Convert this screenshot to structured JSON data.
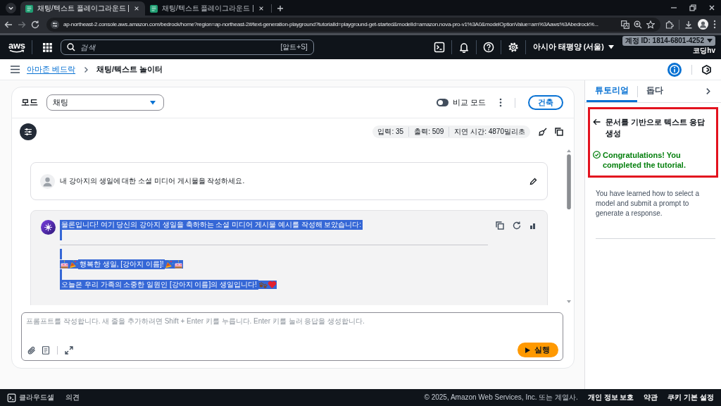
{
  "browser": {
    "tabs": [
      {
        "title": "채팅/텍스트 플레이그라운드 |",
        "selected": true
      },
      {
        "title": "채팅/텍스트 플레이그라운드 |",
        "selected": false
      }
    ],
    "url": "ap-northeast-2.console.aws.amazon.com/bedrock/home?region=ap-northeast-2#/text-generation-playground?tutorialId=playground-get-started&modelId=amazon.nova-pro-v1%3A0&modelOptionValue=arn%3Aaws%3Abedrock%..."
  },
  "console_header": {
    "logo": "aws",
    "search": {
      "placeholder": "검색",
      "shortcut": "[알트+S]"
    },
    "region": "아시아 태평양 (서울)",
    "account_id": "계정 ID: 1814-6801-4252",
    "user": "코딩hv"
  },
  "breadcrumbs": [
    {
      "label": "아마존 베드락",
      "kind": "link"
    },
    {
      "label": "채팅/텍스트 놀이터",
      "kind": "current"
    }
  ],
  "playground": {
    "mode_label": "모드",
    "mode_select": {
      "value": "채팅"
    },
    "compare_toggle": {
      "label": "비교 모드",
      "on": false
    },
    "build_button": "건축",
    "stats": [
      "입력: 35",
      "출력: 509",
      "지연 시간: 4870밀리초"
    ],
    "messages": [
      {
        "kind": "user",
        "text": "내 강아지의 생일에 대한 소셜 미디어 게시물을 작성하세요."
      },
      {
        "kind": "assistant",
        "blocks": [
          {
            "kind": "text",
            "text": "물론입니다! 여기 당신의 강아지 생일을 축하하는 소셜 미디어 게시물 예시를 작성해 보았습니다:",
            "selected": true
          },
          {
            "kind": "blank",
            "selected": true
          },
          {
            "kind": "rule"
          },
          {
            "kind": "blank",
            "selected": true
          },
          {
            "kind": "headline",
            "text": "행복한 생일, [강아지 이름]!",
            "selected": true
          },
          {
            "kind": "blank",
            "selected": true
          },
          {
            "kind": "closing",
            "text": "오늘은 우리 가족의 소중한 일원인 [강아지 이름]의 생일입니다!",
            "selected": true
          }
        ]
      }
    ],
    "prompt": {
      "placeholder": "프롬프트를 작성합니다. 새 줄을 추가하려면 Shift + Enter 키를 누릅니다. Enter 키를 눌러 응답을 생성합니다."
    },
    "run_button": "실행"
  },
  "side_panel": {
    "tabs": [
      {
        "label": "튜토리얼",
        "selected": true
      },
      {
        "label": "돕다",
        "selected": false
      }
    ],
    "tutorial": {
      "highlighted": true,
      "title": "문서를 기반으로 텍스트 응답 생성",
      "success": "Congratulations! You completed the tutorial.",
      "body": "You have learned how to select a model and submit a prompt to generate a response."
    }
  },
  "footer": {
    "cloudshell": "클라우드셸",
    "feedback": "의견",
    "copyright": "© 2025, Amazon Web Services, Inc. 또는 계열사.",
    "links": [
      "개인 정보 보호",
      "약관",
      "쿠키 기본 설정"
    ]
  }
}
